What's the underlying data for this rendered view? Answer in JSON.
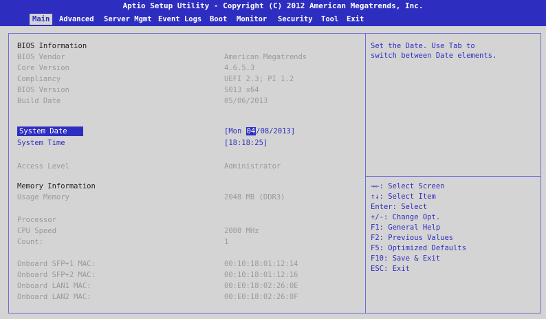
{
  "title": "Aptio Setup Utility - Copyright (C) 2012 American Megatrends, Inc.",
  "menu": [
    "Main",
    "Advanced",
    "Server Mgmt",
    "Event Logs",
    "Boot",
    "Monitor",
    "Security",
    "Tool",
    "Exit"
  ],
  "bios_info": {
    "heading": "BIOS Information",
    "vendor_label": "BIOS Vendor",
    "vendor_value": "American Megatrends",
    "core_label": "Core Version",
    "core_value": "4.6.5.3",
    "compliancy_label": "Compliancy",
    "compliancy_value": "UEFI 2.3; PI 1.2",
    "version_label": "BIOS Version",
    "version_value": "S013 x64",
    "build_label": "Build Date",
    "build_value": "05/06/2013"
  },
  "system_date": {
    "label": "System Date",
    "prefix": "[Mon ",
    "month": "04",
    "rest": "/08/2013]"
  },
  "system_time": {
    "label": "System Time",
    "value": "[18:18:25]"
  },
  "access": {
    "label": "Access Level",
    "value": "Administrator"
  },
  "memory": {
    "heading": "Memory Information",
    "usage_label": "Usage Memory",
    "usage_value": "2048 MB (DDR3)"
  },
  "processor": {
    "label": "Processor",
    "speed_label": "CPU Speed",
    "speed_value": "2000 MHz",
    "count_label": "Count:",
    "count_value": "1"
  },
  "network": [
    {
      "label": "Onboard SFP+1 MAC:",
      "value": "00:10:18:01:12:14"
    },
    {
      "label": "Onboard SFP+2 MAC:",
      "value": "00:10:18:01:12:16"
    },
    {
      "label": "Onboard LAN1 MAC:",
      "value": "00:E0:18:02:26:0E"
    },
    {
      "label": "Onboard LAN2 MAC:",
      "value": "00:E0:18:02:26:0F"
    }
  ],
  "help": {
    "line1": "Set the Date. Use Tab to",
    "line2": "switch between Date elements."
  },
  "keys": [
    "→←: Select Screen",
    "↑↓: Select Item",
    "Enter: Select",
    "+/-: Change Opt.",
    "F1: General Help",
    "F2: Previous Values",
    "F5: Optimized Defaults",
    "F10: Save & Exit",
    "ESC: Exit"
  ],
  "colors": {
    "bar": "#2d2ec0",
    "background": "#d4d4d4",
    "dim_text": "#9a9a9a"
  }
}
